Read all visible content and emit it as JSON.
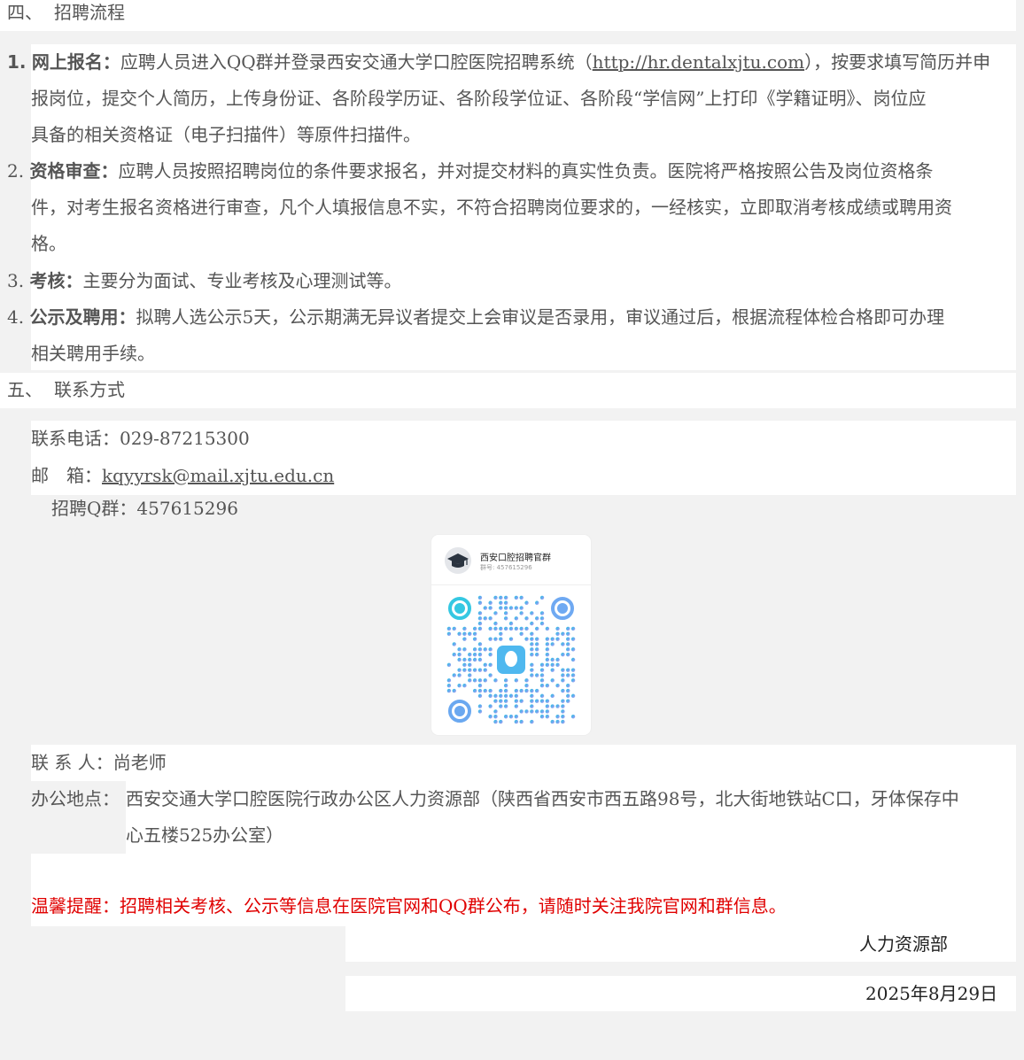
{
  "section4": {
    "num": "四、",
    "title": "招聘流程"
  },
  "steps": [
    {
      "num": "1.",
      "label": "网上报名：",
      "line1_pre": "应聘人员进入QQ群并登录西安交通大学口腔医院招聘系统（",
      "link": "http://hr.dentalxjtu.com",
      "line1_post": "），按要求填写简历并申",
      "line2": "报岗位，提交个人简历，上传身份证、各阶段学历证、各阶段学位证、各阶段“学信网”上打印《学籍证明》、岗位应",
      "line3": "具备的相关资格证（电子扫描件）等原件扫描件。"
    },
    {
      "num": "2.",
      "label": "资格审查：",
      "line1": "应聘人员按照招聘岗位的条件要求报名，并对提交材料的真实性负责。医院将严格按照公告及岗位资格条",
      "line2": "件，对考生报名资格进行审查，凡个人填报信息不实，不符合招聘岗位要求的，一经核实，立即取消考核成绩或聘用资",
      "line3": "格。"
    },
    {
      "num": "3.",
      "label": "考核：",
      "line1": "主要分为面试、专业考核及心理测试等。"
    },
    {
      "num": "4.",
      "label": "公示及聘用：",
      "line1": "拟聘人选公示5天，公示期满无异议者提交上会审议是否录用，审议通过后，根据流程体检合格即可办理",
      "line2": "相关聘用手续。"
    }
  ],
  "section5": {
    "num": "五、",
    "title": "联系方式"
  },
  "contact": {
    "phone_label": "联系电话：",
    "phone": "029-87215300",
    "email_label": "邮　箱：",
    "email": "kqyyrsk@mail.xjtu.edu.cn",
    "qq_label": "招聘Q群：",
    "qq": "457615296",
    "person_label": "联 系 人：",
    "person": "尚老师",
    "office_label": "办公地点：",
    "office_line1": "西安交通大学口腔医院行政办公区人力资源部（陕西省西安市西五路98号，北大街地铁站C口，牙体保存中",
    "office_line2": "心五楼525办公室）"
  },
  "qr_card": {
    "group_name": "西安口腔招聘官群",
    "group_number": "群号: 457615296"
  },
  "reminder": "温馨提醒：招聘相关考核、公示等信息在医院官网和QQ群公布，请随时关注我院官网和群信息。",
  "signature": {
    "dept": "人力资源部",
    "date": "2025年8月29日"
  },
  "colors": {
    "text": "#555555",
    "reminder": "#e00000",
    "background": "#f2f2f2",
    "panel": "#ffffff"
  }
}
